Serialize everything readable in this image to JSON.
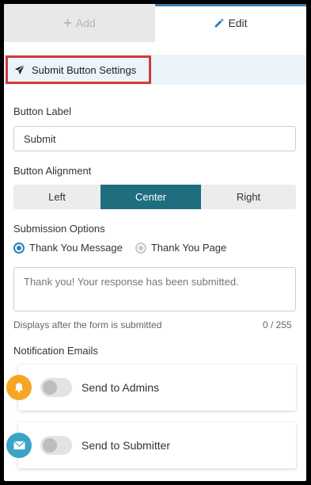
{
  "tabs": [
    {
      "label": "Add",
      "icon": "plus-icon",
      "active": false
    },
    {
      "label": "Edit",
      "icon": "pencil-icon",
      "active": true
    }
  ],
  "section": {
    "title": "Submit Button Settings",
    "icon": "paper-plane-icon"
  },
  "button_label": {
    "label": "Button Label",
    "value": "Submit"
  },
  "alignment": {
    "label": "Button Alignment",
    "options": [
      "Left",
      "Center",
      "Right"
    ],
    "selected": "Center"
  },
  "submission": {
    "label": "Submission Options",
    "options": [
      {
        "label": "Thank You Message",
        "selected": true
      },
      {
        "label": "Thank You Page",
        "selected": false
      }
    ],
    "message_value": "Thank you! Your response has been submitted.",
    "hint": "Displays after the form is submitted",
    "counter": "0 / 255"
  },
  "notifications": {
    "label": "Notification Emails",
    "items": [
      {
        "label": "Send to Admins",
        "icon": "bell-icon",
        "color": "#f5a623",
        "enabled": false
      },
      {
        "label": "Send to Submitter",
        "icon": "envelope-icon",
        "color": "#3aa3c7",
        "enabled": false
      }
    ]
  },
  "colors": {
    "accent": "#2c7fb8",
    "selected_segment": "#1f6e80",
    "highlight_border": "#d43a3a"
  }
}
